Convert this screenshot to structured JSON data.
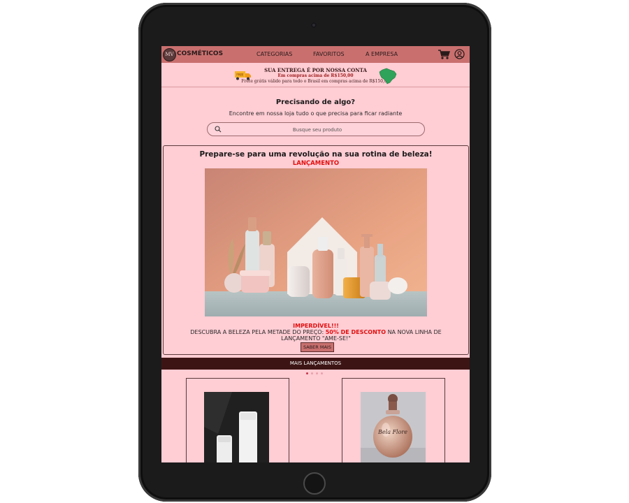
{
  "brand": {
    "logo_text": "MV",
    "name": "COSMÉTICOS"
  },
  "nav": {
    "links": [
      "CATEGORIAS",
      "FAVORITOS",
      "A EMPRESA"
    ]
  },
  "shipping": {
    "headline": "SUA ENTREGA É POR NOSSA CONTA",
    "highlight": "Em compras acima de R$150,00",
    "detail": "Frete grátis válido para todo o Brasil em compras acima de R$150,00",
    "truck_label": "FREE"
  },
  "search": {
    "title": "Precisando de algo?",
    "subtitle": "Encontre em nossa loja tudo o que precisa para ficar radiante",
    "placeholder": "Busque seu produto"
  },
  "promo": {
    "title": "Prepare-se para uma revolução na sua rotina de beleza!",
    "tag": "LANÇAMENTO",
    "alert": "IMPERDÍVEL!!!",
    "desc_before": "DESCUBRA A BELEZA PELA METADE DO PREÇO: ",
    "desc_highlight": "50% DE DESCONTO",
    "desc_after": " NA NOVA LINHA DE LANÇAMENTO \"AME-SE!\"",
    "button": "SABER MAIS"
  },
  "launches": {
    "title": "MAIS LANÇAMENTOS",
    "carousel_dots": 4,
    "active_dot": 0,
    "product_2_label": "Bela Flore"
  },
  "colors": {
    "background": "#ffcdd4",
    "nav": "#c9706f",
    "accent_red": "#e01010",
    "dark_bar": "#3d1414"
  }
}
